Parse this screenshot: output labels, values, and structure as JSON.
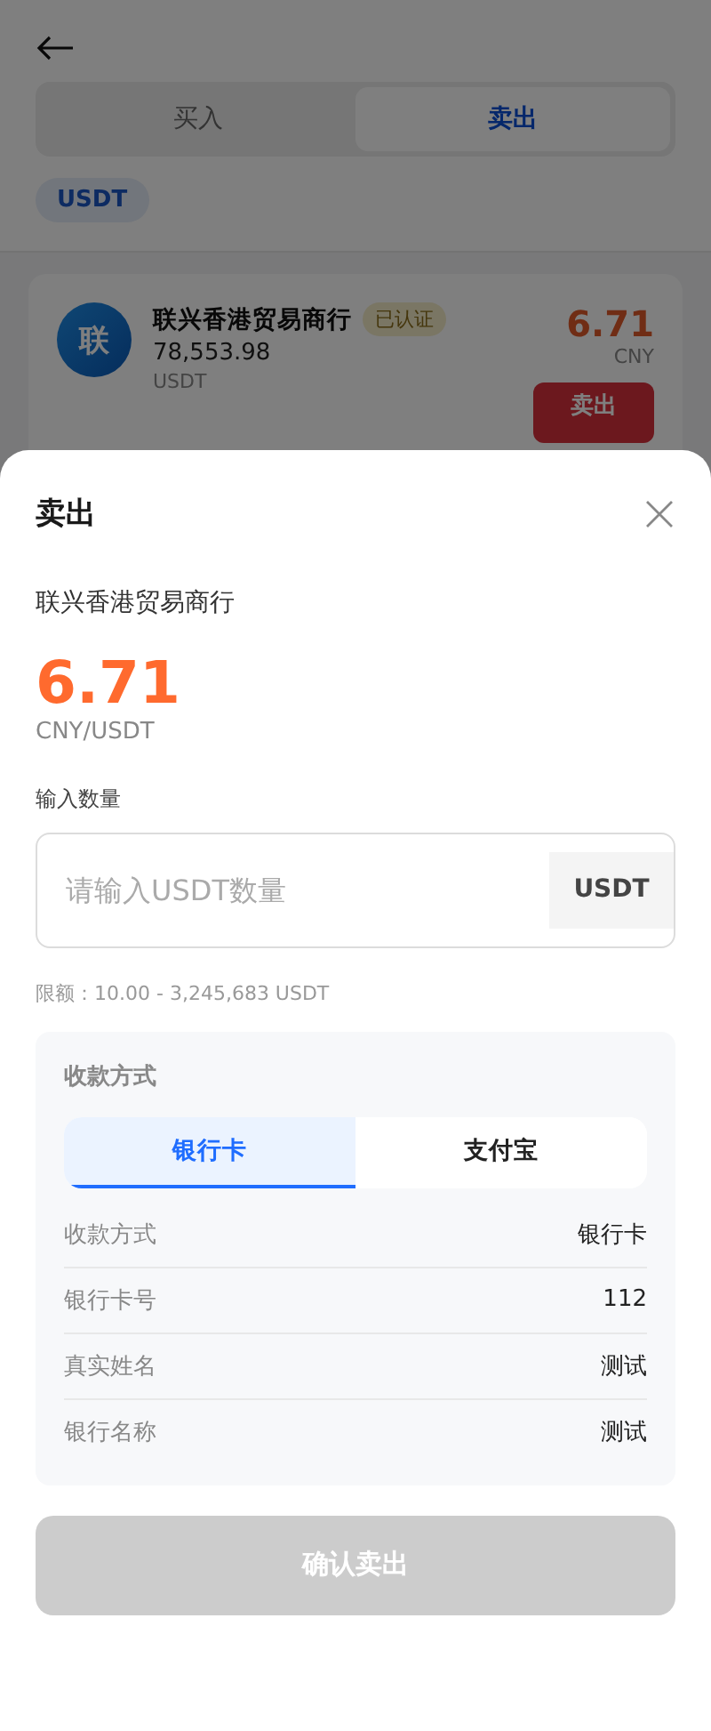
{
  "back_page": {
    "trade_tabs": [
      {
        "label": "买入",
        "selected": false
      },
      {
        "label": "卖出",
        "selected": true
      }
    ],
    "coin_chip": "USDT",
    "merchant_card": {
      "avatar": "联",
      "name": "联兴香港贸易商行",
      "badge": "已认证",
      "amount": "78,553.98",
      "amount_unit": "USDT",
      "price": "6.71",
      "currency": "CNY",
      "action": "卖出"
    }
  },
  "sheet": {
    "title": "卖出",
    "merchant": "联兴香港贸易商行",
    "price": "6.71",
    "price_unit": "CNY/USDT",
    "quantity_label": "输入数量",
    "quantity_placeholder": "请输入USDT数量",
    "quantity_suffix": "USDT",
    "limit": "限额：10.00 - 3,245,683 USDT",
    "payment": {
      "heading": "收款方式",
      "tabs": [
        {
          "label": "银行卡",
          "selected": true
        },
        {
          "label": "支付宝",
          "selected": false
        }
      ],
      "rows": [
        {
          "label": "收款方式",
          "value": "银行卡"
        },
        {
          "label": "银行卡号",
          "value": "112"
        },
        {
          "label": "真实姓名",
          "value": "测试"
        },
        {
          "label": "银行名称",
          "value": "测试"
        }
      ]
    },
    "confirm": {
      "label": "确认卖出",
      "disabled": true
    }
  }
}
